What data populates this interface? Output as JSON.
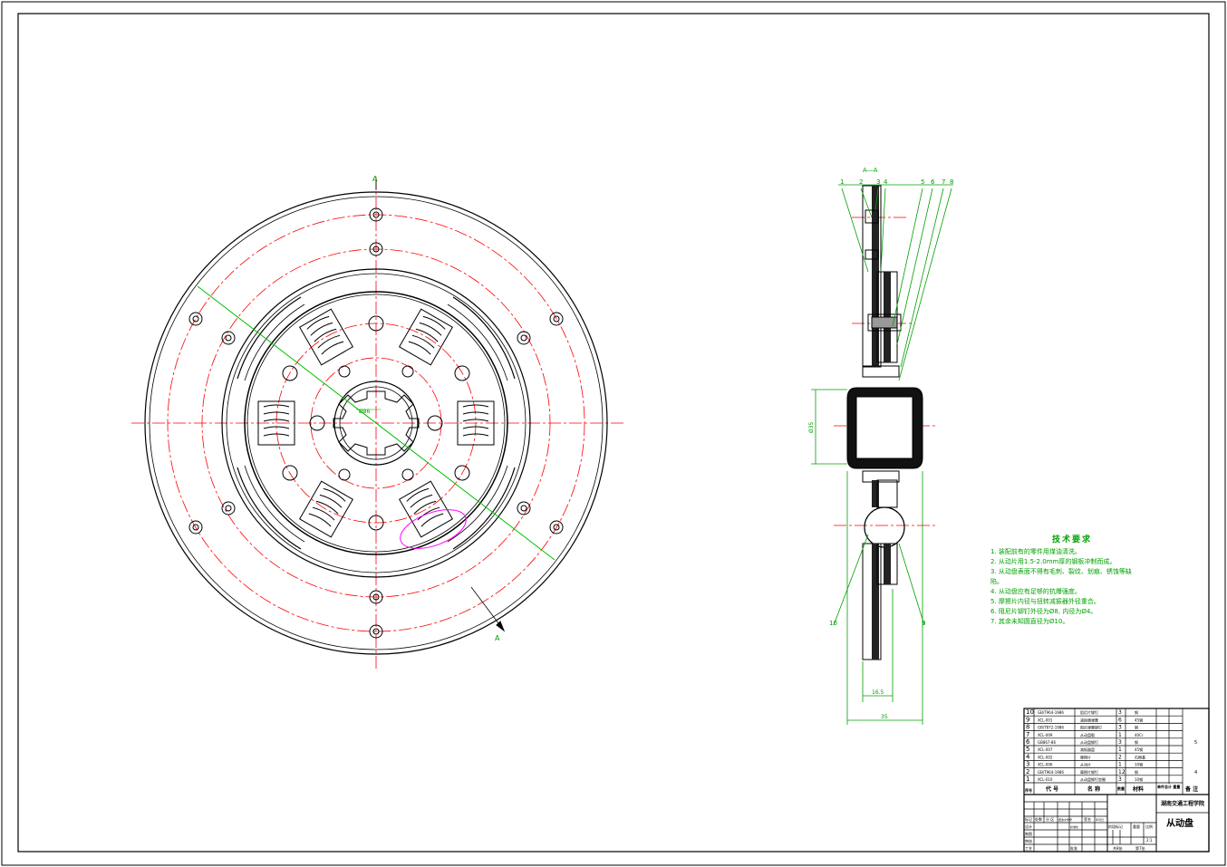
{
  "section_label": "A—A",
  "cut_marks": {
    "top": "A",
    "bottom": "A"
  },
  "front_view": {
    "center_dim": "Ø86"
  },
  "section_view": {
    "callouts_top": [
      "1",
      "2",
      "3",
      "4",
      "5",
      "6",
      "7",
      "8"
    ],
    "callout_left": "10",
    "callout_right": "9",
    "dim_height": "Ø35",
    "dim_inner": "16.5",
    "dim_overall": "35"
  },
  "tech_requirements": {
    "title": "技术要求",
    "items": [
      "1. 装配前有的零件用煤油清洗。",
      "2. 从动片用1.5-2.0mm厚的钢板冲制而成。",
      "3. 从动盘表面不得有毛刺、裂纹、划痕、锈蚀等缺",
      "陷。",
      "4. 从动盘应有足够的抗爆强度。",
      "5. 摩擦片内径与扭转减振器外径重合。",
      "6. 阻尼片铆钉外径为Ø8, 内径为Ø4。",
      "7. 其余未知圆直径为Ø10。"
    ]
  },
  "parts_list": {
    "rows": [
      {
        "no": "10",
        "code": "GB/T964-1986",
        "name": "阻尼片铆钉",
        "qty": "3",
        "material": "钢",
        "remark": ""
      },
      {
        "no": "9",
        "code": "XCL-001",
        "name": "减振器弹簧",
        "qty": "6",
        "material": "45钢",
        "remark": ""
      },
      {
        "no": "8",
        "code": "GB/T872-1986",
        "name": "阻尼弹簧铆钉",
        "qty": "3",
        "material": "钢",
        "remark": ""
      },
      {
        "no": "7",
        "code": "XCL-009",
        "name": "从动盘毂",
        "qty": "1",
        "material": "40Cr",
        "remark": ""
      },
      {
        "no": "6",
        "code": "GB867-86",
        "name": "从动盘铆钉",
        "qty": "3",
        "material": "钢",
        "remark": "5"
      },
      {
        "no": "5",
        "code": "XCL-007",
        "name": "减振器盘",
        "qty": "1",
        "material": "45钢",
        "remark": ""
      },
      {
        "no": "4",
        "code": "XCL-002",
        "name": "摩擦片",
        "qty": "2",
        "material": "石棉基",
        "remark": ""
      },
      {
        "no": "3",
        "code": "XCL-006",
        "name": "从动片",
        "qty": "1",
        "material": "10钢",
        "remark": ""
      },
      {
        "no": "2",
        "code": "GB/T964-1986",
        "name": "摩擦片铆钉",
        "qty": "12",
        "material": "钢",
        "remark": "4"
      },
      {
        "no": "1",
        "code": "XCL-010",
        "name": "从动盘铆钉垫圈",
        "qty": "3",
        "material": "10钢",
        "remark": ""
      }
    ],
    "header": {
      "no": "序号",
      "code": "代 号",
      "name": "名 称",
      "qty": "数量",
      "material": "材料",
      "weight": "单件总计 重量",
      "remark": "备 注"
    }
  },
  "title_block": {
    "school": "湖南交通工程学院",
    "drawing_name": "从动盘",
    "scale": "2:1",
    "sheets_total": "共8张",
    "sheet_no": "第7张",
    "labels": {
      "mark": "标记",
      "count": "处数",
      "zone": "分 区",
      "change_doc": "更改文件号",
      "sign": "签名",
      "date": "年月日",
      "design": "设计",
      "standard": "标准化",
      "drafting": "制图",
      "review": "审核",
      "process": "工艺",
      "approve": "批准",
      "stage_mark": "阶段标记",
      "weight": "重量",
      "scale": "比例"
    }
  },
  "colors": {
    "outline": "#000000",
    "centerline": "#ff0000",
    "dimension": "#00a000",
    "highlight": "#ff00ff",
    "frame": "#000000"
  }
}
